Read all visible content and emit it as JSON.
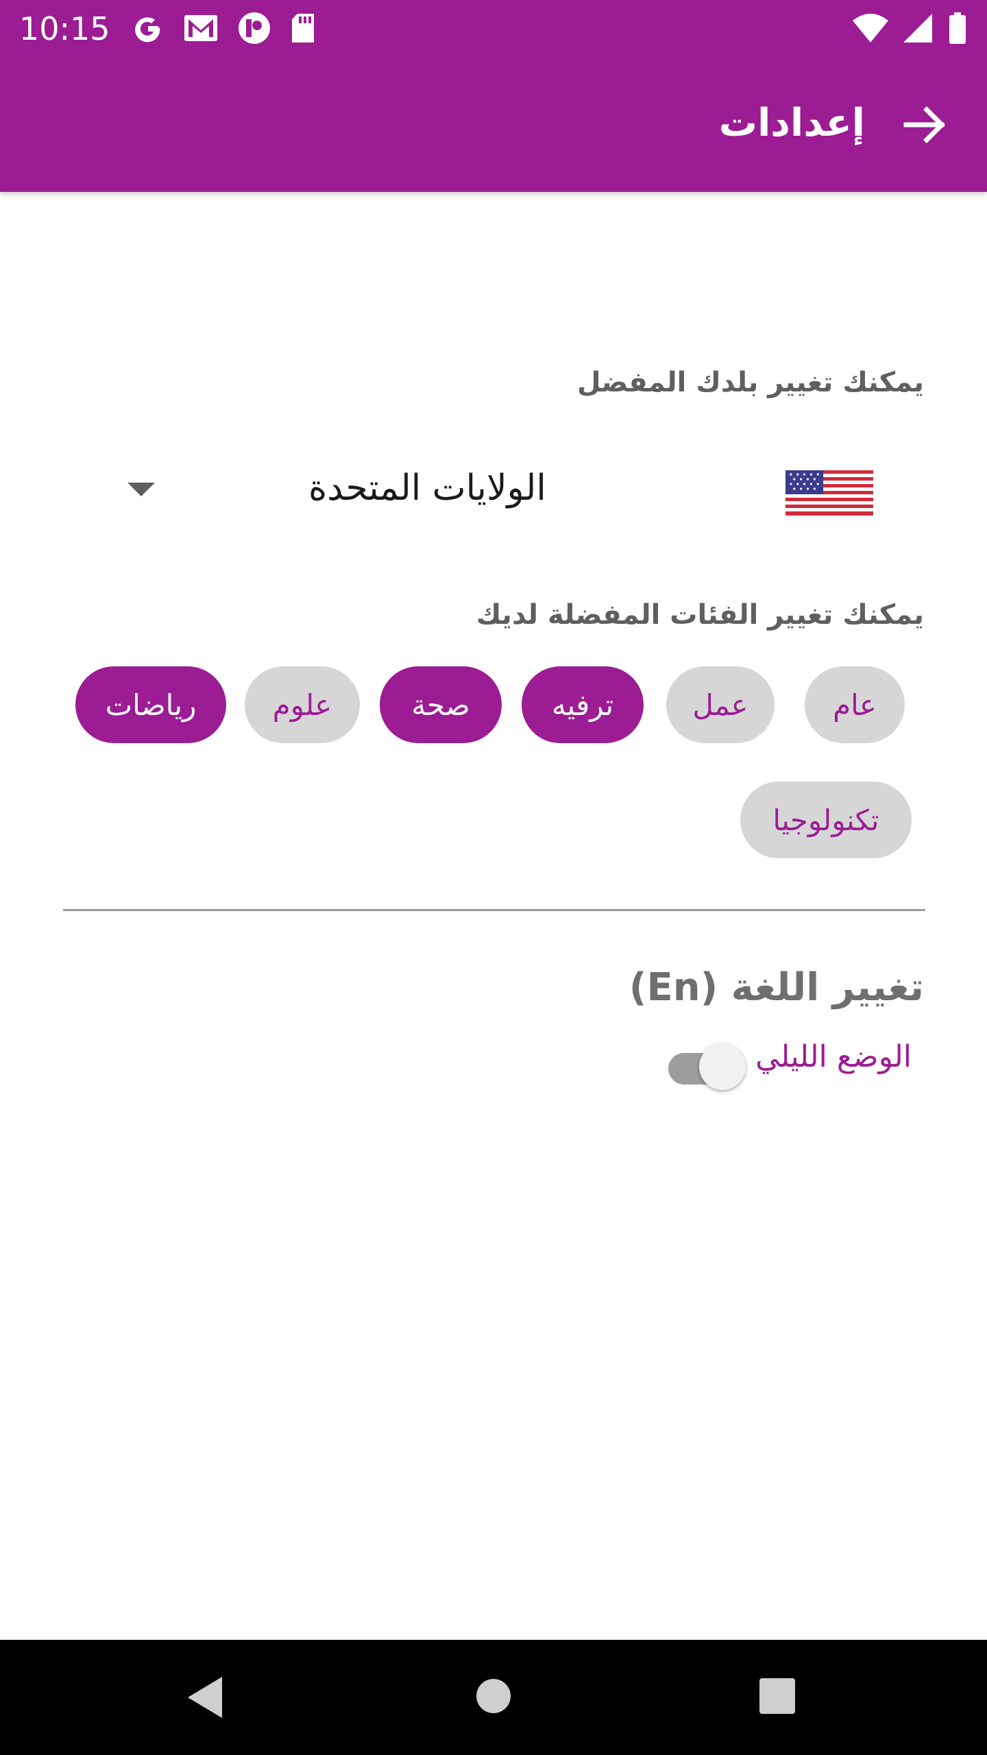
{
  "status": {
    "time": "10:15",
    "left_icons": [
      "google-icon",
      "gmail-icon",
      "app-icon",
      "sdcard-icon"
    ],
    "right_icons": [
      "wifi-icon",
      "signal-icon",
      "battery-icon"
    ]
  },
  "appbar": {
    "title": "إعدادات",
    "back_icon": "arrow-right-icon",
    "color": "#9c1c94"
  },
  "country": {
    "label": "يمكنك تغيير بلدك المفضل",
    "selected": "الولايات المتحدة",
    "flag_icon": "us-flag-icon"
  },
  "categories": {
    "label": "يمكنك تغيير الفئات المفضلة لديك",
    "chips": [
      {
        "label": "عام",
        "selected": false
      },
      {
        "label": "عمل",
        "selected": false
      },
      {
        "label": "ترفيه",
        "selected": true
      },
      {
        "label": "صحة",
        "selected": true
      },
      {
        "label": "علوم",
        "selected": false
      },
      {
        "label": "رياضات",
        "selected": true
      },
      {
        "label": "تكنولوجيا",
        "selected": false
      }
    ]
  },
  "language": {
    "label": "تغيير اللغة (En)"
  },
  "night_mode": {
    "label": "الوضع الليلي",
    "enabled": false
  },
  "navbar": {
    "icons": [
      "back-triangle-icon",
      "home-circle-icon",
      "recents-square-icon"
    ]
  }
}
